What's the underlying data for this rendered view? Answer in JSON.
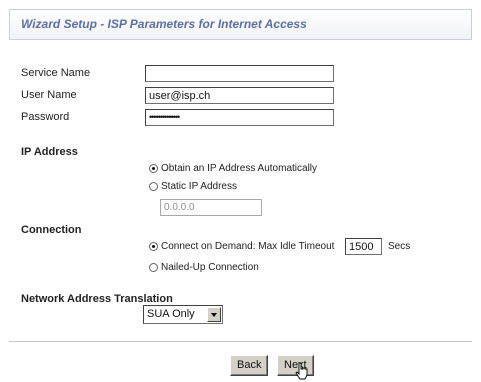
{
  "header": {
    "title": "Wizard Setup - ISP Parameters for Internet Access"
  },
  "service_name": {
    "label": "Service Name",
    "value": ""
  },
  "user_name": {
    "label": "User Name",
    "value": "user@isp.ch"
  },
  "password": {
    "label": "Password",
    "value": "••••••••••••••"
  },
  "ip_address": {
    "heading": "IP Address",
    "option_auto": "Obtain an IP Address Automatically",
    "option_static": "Static IP Address",
    "static_value": "0.0.0.0",
    "selected": "auto"
  },
  "connection": {
    "heading": "Connection",
    "option_demand": "Connect on Demand: Max Idle Timeout",
    "timeout_value": "1500",
    "timeout_unit": "Secs",
    "option_nailed": "Nailed-Up Connection",
    "selected": "demand"
  },
  "nat": {
    "heading": "Network Address Translation",
    "selected": "SUA Only"
  },
  "buttons": {
    "back": "Back",
    "next": "Next"
  },
  "icons": {
    "cursor": "hand-pointer-icon",
    "dropdown": "chevron-down-icon"
  }
}
